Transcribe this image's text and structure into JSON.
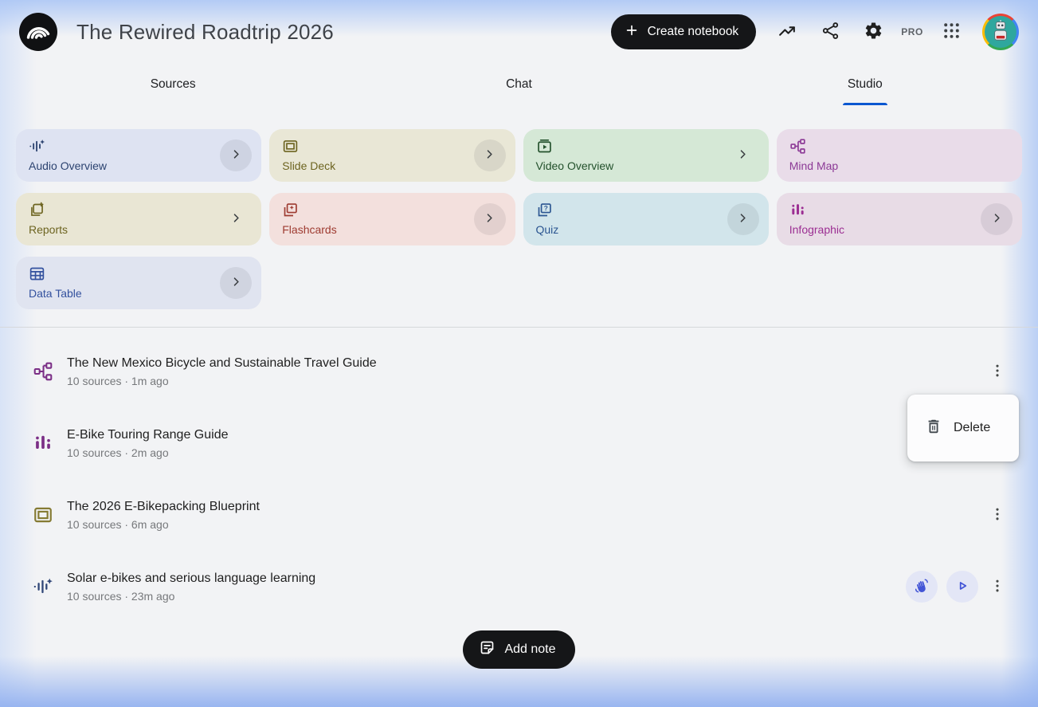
{
  "header": {
    "title": "The Rewired Roadtrip 2026",
    "create_notebook_label": "Create notebook",
    "pro_badge": "PRO",
    "icons": [
      "notebooklm-logo",
      "plus-icon",
      "trending-up-icon",
      "share-icon",
      "settings-gear-icon",
      "apps-grid-icon",
      "robot-avatar"
    ]
  },
  "tabs": {
    "sources": "Sources",
    "chat": "Chat",
    "studio": "Studio",
    "active_tab": "Studio"
  },
  "studio_cards": [
    {
      "label": "Audio Overview",
      "icon": "audio-waveform-sparkle-icon",
      "bg": "#dee3f2",
      "fg": "#2c4370",
      "chevron": "circle"
    },
    {
      "label": "Slide Deck",
      "icon": "slide-deck-icon",
      "bg": "#e9e7d6",
      "fg": "#6d6420",
      "chevron": "circle"
    },
    {
      "label": "Video Overview",
      "icon": "video-overview-icon",
      "bg": "#d5e8d6",
      "fg": "#23512c",
      "chevron": "bare"
    },
    {
      "label": "Mind Map",
      "icon": "mind-map-icon",
      "bg": "#e9dce9",
      "fg": "#8c3a96",
      "chevron": "none"
    },
    {
      "label": "Reports",
      "icon": "reports-icon",
      "bg": "#e9e6d4",
      "fg": "#6d6420",
      "chevron": "bare"
    },
    {
      "label": "Flashcards",
      "icon": "flashcards-icon",
      "bg": "#f3e0dd",
      "fg": "#9e3b31",
      "chevron": "circle"
    },
    {
      "label": "Quiz",
      "icon": "quiz-icon",
      "bg": "#d2e5eb",
      "fg": "#2b5591",
      "chevron": "circle"
    },
    {
      "label": "Infographic",
      "icon": "infographic-bars-icon",
      "bg": "#e8dce6",
      "fg": "#9c2f93",
      "chevron": "circle"
    },
    {
      "label": "Data Table",
      "icon": "data-table-icon",
      "bg": "#e0e4f0",
      "fg": "#33519e",
      "chevron": "circle"
    }
  ],
  "artifacts": [
    {
      "title": "The New Mexico Bicycle and Sustainable Travel Guide",
      "meta": "10 sources · 1m ago",
      "icon": "mind-map-icon"
    },
    {
      "title": "E-Bike Touring Range Guide",
      "meta": "10 sources · 2m ago",
      "icon": "infographic-bars-icon"
    },
    {
      "title": "The 2026 E-Bikepacking Blueprint",
      "meta": "10 sources · 6m ago",
      "icon": "slide-deck-icon"
    },
    {
      "title": "Solar e-bikes and serious language learning",
      "meta": "10 sources · 23m ago",
      "icon": "audio-waveform-sparkle-icon",
      "actions": [
        "interactive-hand-icon",
        "play-icon",
        "kebab-menu-icon"
      ]
    }
  ],
  "context_menu": {
    "delete_label": "Delete",
    "icon": "trash-icon"
  },
  "footer": {
    "add_note_label": "Add note",
    "icon": "note-icon"
  },
  "colors": {
    "accent_blue": "#0b57d0",
    "button_black": "#151618",
    "page_background": "#f2f3f5",
    "edge_glow_blue": "#a8c4f5",
    "audio_action_blue": "#4355d6"
  }
}
